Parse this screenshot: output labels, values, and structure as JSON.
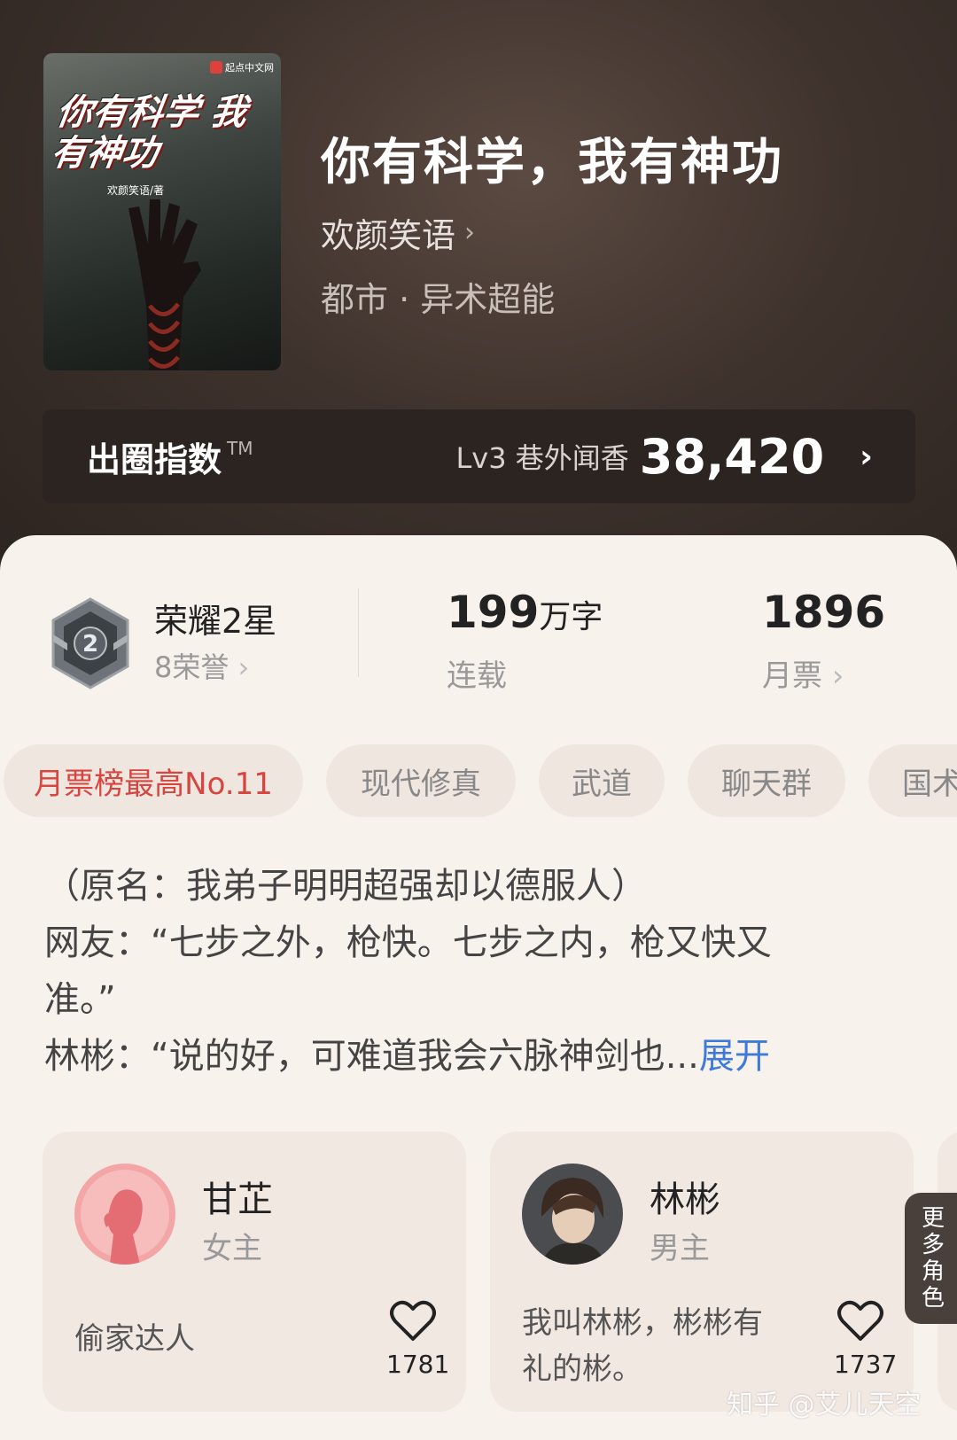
{
  "book": {
    "cover_badge": "起点中文网",
    "cover_title": "你有科学 我有神功",
    "cover_author": "欢颜笑语/著",
    "title": "你有科学，我有神功",
    "author": "欢颜笑语",
    "genre": "都市 · 异术超能"
  },
  "index_bar": {
    "label": "出圈指数",
    "tm": "TM",
    "level": "Lv3 巷外闻香",
    "score": "38,420"
  },
  "stats": {
    "honor_title": "荣耀2星",
    "honor_sub": "8荣誉",
    "honor_level": "2",
    "word_count": "199",
    "word_unit": "万字",
    "status": "连载",
    "monthly_votes": "1896",
    "monthly_label": "月票"
  },
  "tags": [
    "月票榜最高No.11",
    "现代修真",
    "武道",
    "聊天群",
    "国术"
  ],
  "synopsis": {
    "line1": "（原名：我弟子明明超强却以德服人）",
    "line2": "网友：“七步之外，枪快。七步之内，枪又快又",
    "line3": "准。”",
    "line4": "林彬：“说的好，可难道我会六脉神剑也...",
    "expand": "展开"
  },
  "roles": [
    {
      "name": "甘芷",
      "type": "女主",
      "desc": "偷家达人",
      "likes": "1781"
    },
    {
      "name": "林彬",
      "type": "男主",
      "desc": "我叫林彬，彬彬有礼的彬。",
      "likes": "1737"
    }
  ],
  "more_roles": "更多角色",
  "watermark": "知乎 @艾儿天空",
  "icons": {
    "chevron": "chevron-right-icon",
    "heart": "heart-icon",
    "medal": "medal-icon"
  },
  "colors": {
    "accent_red": "#d8453f",
    "link_blue": "#3e7ad6",
    "hero_bg": "#3e322c"
  }
}
